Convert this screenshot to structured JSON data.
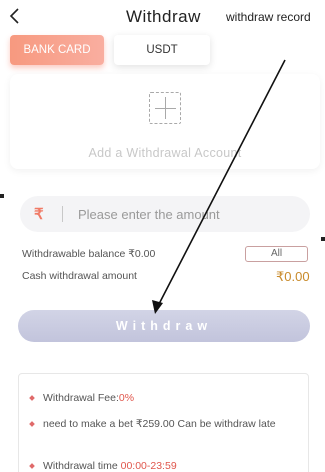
{
  "header": {
    "back_icon": "chevron-left-icon",
    "title": "Withdraw",
    "record_link": "withdraw record"
  },
  "tabs": [
    {
      "label": "BANK CARD",
      "active": true
    },
    {
      "label": "USDT",
      "active": false
    }
  ],
  "account": {
    "add_icon": "plus-icon",
    "label": "Add a Withdrawal Account"
  },
  "amount": {
    "currency_icon": "rupee-icon",
    "currency_symbol": "₹",
    "placeholder": "Please enter the amount",
    "value": ""
  },
  "balance": {
    "withdrawable_label": "Withdrawable balance ₹0.00",
    "all_button": "All",
    "cash_label": "Cash withdrawal amount",
    "cash_value": "₹0.00"
  },
  "withdraw_button": "Withdraw",
  "notes": [
    {
      "text": "Withdrawal Fee:",
      "highlight": "0%"
    },
    {
      "text": "need to make a bet ₹259.00 Can be withdraw late",
      "highlight": ""
    },
    {
      "text": "Withdrawal time ",
      "highlight": "00:00-23:59"
    }
  ],
  "colors": {
    "accent": "#f7997f",
    "highlight": "#e0564c",
    "cash_value": "#c88a2a",
    "button": "#c8cae0"
  }
}
